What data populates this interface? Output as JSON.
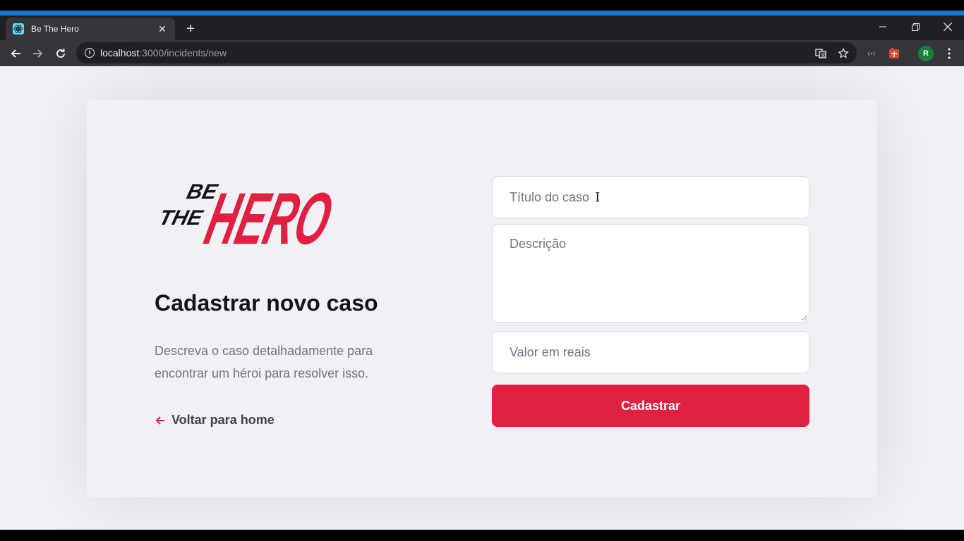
{
  "browser": {
    "tab_title": "Be The Hero",
    "tab_close": "✕",
    "new_tab": "+",
    "url_host": "localhost",
    "url_path": ":3000/incidents/new",
    "profile_initial": "R"
  },
  "page": {
    "logo": {
      "line1": "BE",
      "line2": "THE",
      "word": "HERO"
    },
    "title": "Cadastrar novo caso",
    "description": "Descreva o caso detalhadamente para encontrar um héroi para resolver isso.",
    "back_link": "Voltar para home",
    "form": {
      "title_placeholder": "Título do caso",
      "description_placeholder": "Descrição",
      "value_placeholder": "Valor em reais",
      "submit": "Cadastrar"
    }
  },
  "colors": {
    "brand": "#e02041",
    "background": "#f0f0f5",
    "heading": "#13131a",
    "text": "#737380",
    "browser_accent": "#1976d2"
  }
}
